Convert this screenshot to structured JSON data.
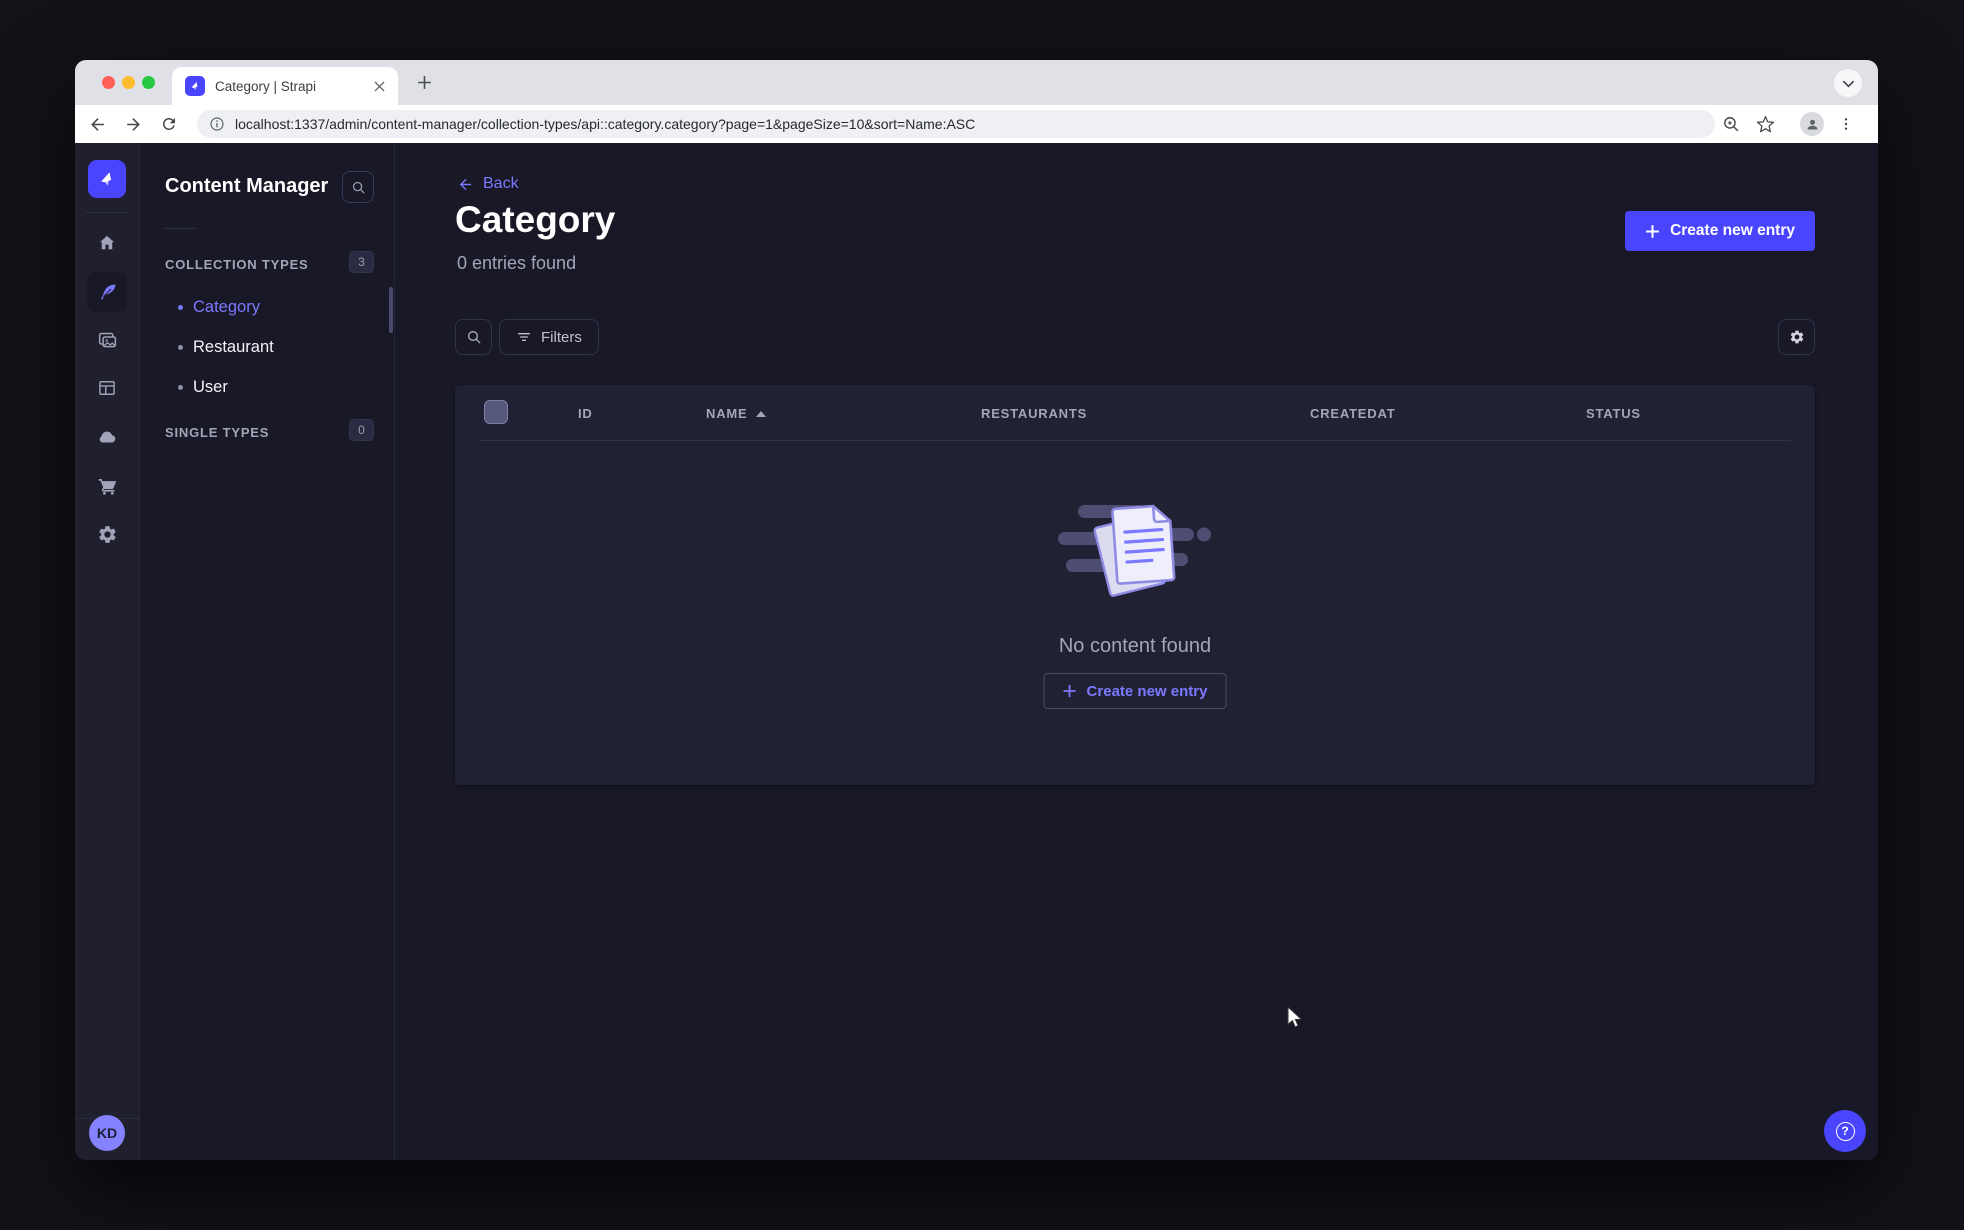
{
  "browser": {
    "tab_title": "Category | Strapi",
    "url": "localhost:1337/admin/content-manager/collection-types/api::category.category?page=1&pageSize=10&sort=Name:ASC"
  },
  "subnav": {
    "title": "Content Manager",
    "collection_types": {
      "label": "COLLECTION TYPES",
      "badge": "3",
      "items": [
        {
          "label": "Category",
          "active": true
        },
        {
          "label": "Restaurant",
          "active": false
        },
        {
          "label": "User",
          "active": false
        }
      ]
    },
    "single_types": {
      "label": "SINGLE TYPES",
      "badge": "0"
    }
  },
  "main": {
    "back_label": "Back",
    "title": "Category",
    "subtitle": "0 entries found",
    "create_button": "Create new entry",
    "filters_button": "Filters",
    "table": {
      "headers": [
        "ID",
        "NAME",
        "RESTAURANTS",
        "CREATEDAT",
        "STATUS"
      ],
      "sorted_column": "NAME"
    },
    "empty": {
      "message": "No content found",
      "create_button": "Create new entry"
    }
  },
  "user": {
    "initials": "KD"
  },
  "icons": {
    "help_glyph": "?"
  },
  "colors": {
    "primary": "#4945ff",
    "primary_light": "#7b79ff",
    "page_bg": "#181826",
    "card_bg": "#212134",
    "border": "#32324d"
  }
}
